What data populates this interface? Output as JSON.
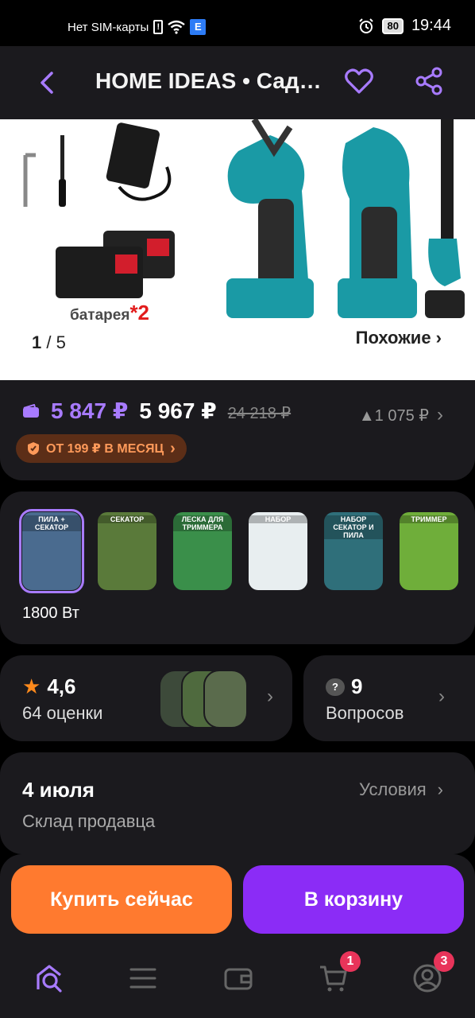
{
  "status_bar": {
    "sim_text": "Нет SIM-карты",
    "network_badge": "E",
    "battery": "80",
    "time": "19:44"
  },
  "header": {
    "title": "HOME IDEAS • Садовый секатор",
    "accent_color": "#a87bff"
  },
  "gallery": {
    "current": "1",
    "total": "/ 5",
    "similar_label": "Похожие ›",
    "battery_label": "батарея",
    "battery_qty": "*2"
  },
  "price": {
    "wallet_price": "5 847 ₽",
    "price": "5 967 ₽",
    "old_price": "24 218 ₽",
    "diff": "▲1 075 ₽",
    "installment": "ОТ 199 ₽ В МЕСЯЦ"
  },
  "variants": {
    "thumbs": [
      {
        "label": "ПИЛА + СЕКАТОР",
        "color": "#4a6b8f"
      },
      {
        "label": "СЕКАТОР",
        "color": "#5a7a3a"
      },
      {
        "label": "ЛЕСКА ДЛЯ ТРИММЕРА",
        "color": "#3a8f4a"
      },
      {
        "label": "НАБОР",
        "color": "#e8eef0"
      },
      {
        "label": "НАБОР СЕКАТОР И ПИЛА",
        "color": "#2f6f7a"
      },
      {
        "label": "ТРИММЕР",
        "color": "#6fae3a"
      }
    ],
    "selected_name": "1800 Вт"
  },
  "rating": {
    "value": "4,6",
    "count": "64 оценки"
  },
  "questions": {
    "count": "9",
    "label": "Вопросов"
  },
  "delivery": {
    "date": "4 июля",
    "source": "Склад продавца",
    "terms": "Условия"
  },
  "actions": {
    "buy": "Купить сейчас",
    "cart": "В корзину"
  },
  "nav": {
    "cart_badge": "1",
    "profile_badge": "3"
  }
}
